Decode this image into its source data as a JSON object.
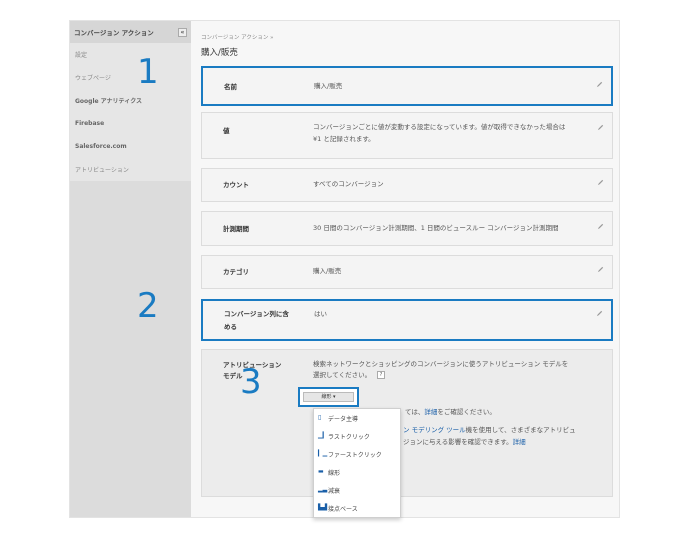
{
  "sidebar": {
    "header": "コンバージョン アクション",
    "collapse_icon": "«",
    "items": [
      "設定",
      "ウェブページ",
      "Google アナリティクス",
      "Firebase",
      "Salesforce.com",
      "アトリビューション"
    ]
  },
  "main": {
    "breadcrumb": "コンバージョン アクション »",
    "title": "購入/販売"
  },
  "rows": [
    {
      "label": "名前",
      "value": "購入/販売"
    },
    {
      "label": "値",
      "value_line1": "コンバージョンごとに値が変動する設定になっています。値が取得できなかった場合は",
      "value_line2": "¥1 と記録されます。"
    },
    {
      "label": "カウント",
      "value": "すべてのコンバージョン"
    },
    {
      "label": "計測期間",
      "value": "30 日間のコンバージョン計測期間、1 日間のビュースルー コンバージョン計測期間"
    },
    {
      "label": "カテゴリ",
      "value": "購入/販売"
    },
    {
      "label_line1": "コンバージョン列に含",
      "label_line2": "める",
      "value": "はい"
    }
  ],
  "attribution": {
    "label_line1": "アトリビューション",
    "label_line2": "モデル",
    "desc_line1": "検索ネットワークとショッピングのコンバージョンに使うアトリビューション モデルを",
    "desc_line2": "選択してください。",
    "help": "?",
    "select_label": "線形 ▾",
    "text_a": "ては、",
    "link_a": "詳細",
    "text_a2": "をご確認ください。",
    "text_b1_link": "ン モデリング ツール",
    "text_b1": "機を使用して、さまざまなアトリビュ",
    "text_b2": "ジョンに与える影響を確認できます。",
    "link_b": "詳細"
  },
  "menu_items": [
    {
      "icon": "▯",
      "label": "データ主導"
    },
    {
      "icon": "▁▎",
      "label": "ラストクリック"
    },
    {
      "icon": "▎▁",
      "label": "ファーストクリック"
    },
    {
      "icon": "▬",
      "label": "線形"
    },
    {
      "icon": "▂▃",
      "label": "減衰"
    },
    {
      "icon": "▙▟",
      "label": "接点ベース"
    }
  ],
  "annotations": [
    "1",
    "2",
    "3"
  ],
  "colors": {
    "highlight": "#1a7bc2",
    "link": "#1a5fa8"
  }
}
